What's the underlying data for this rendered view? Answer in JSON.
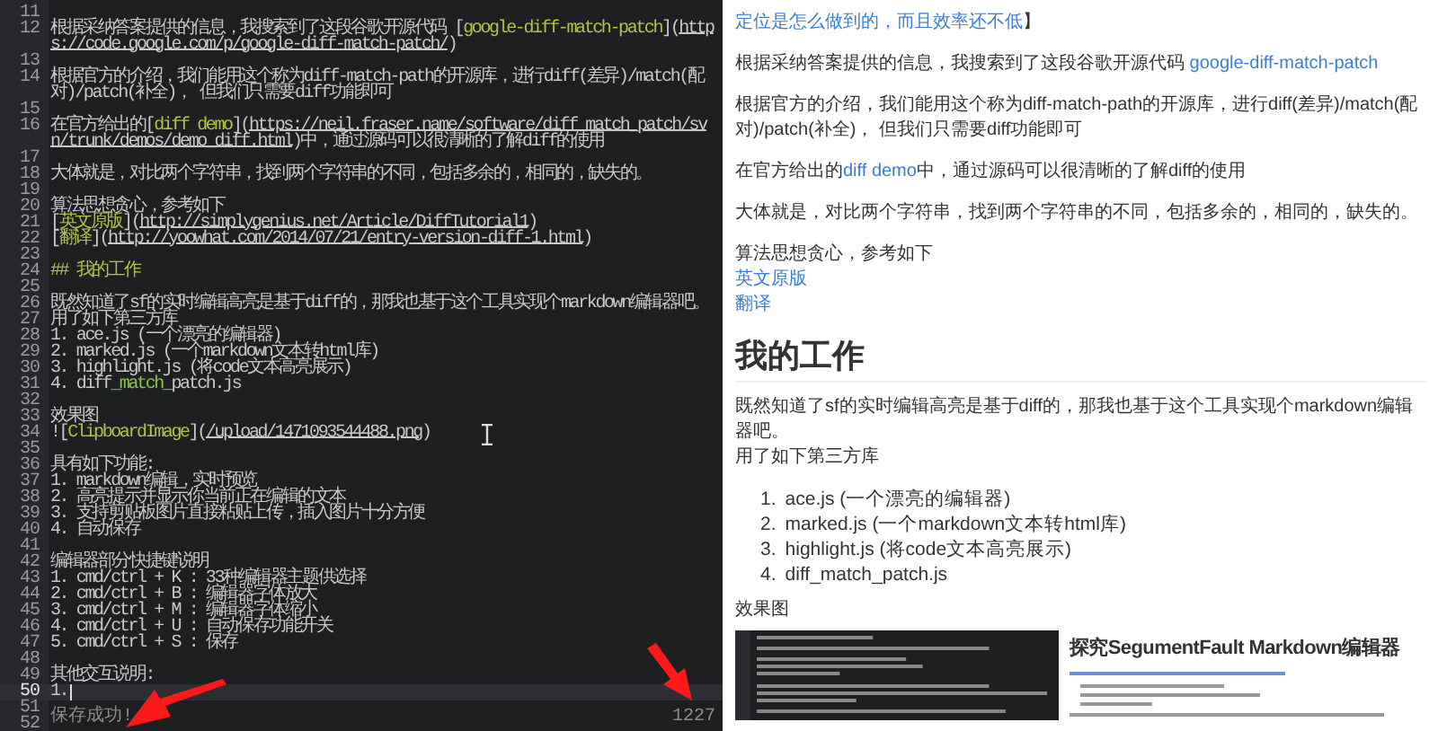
{
  "editor": {
    "lines": [
      {
        "number": "11",
        "current": false
      },
      {
        "number": "12",
        "current": false,
        "segments": [
          {
            "kind": "text",
            "text": "根据采纳答案提供的信息，我搜索到了这段谷歌开源代码 ["
          },
          {
            "kind": "label",
            "text": "google-diff-match-patch"
          },
          {
            "kind": "text",
            "text": "]("
          },
          {
            "kind": "url",
            "text": "https://code.google.com/p/google-diff-match-patch/"
          },
          {
            "kind": "text",
            "text": ")"
          }
        ]
      },
      {
        "number": "13",
        "current": false
      },
      {
        "number": "14",
        "current": false,
        "segments": [
          {
            "kind": "text",
            "text": "根据官方的介绍，我们能用这个称为diff-match-path的开源库，进行diff(差异)/match(配对)/patch(补全)， 但我们只需要diff功能即可"
          }
        ]
      },
      {
        "number": "15",
        "current": false
      },
      {
        "number": "16",
        "current": false,
        "segments": [
          {
            "kind": "text",
            "text": "在官方给出的["
          },
          {
            "kind": "label",
            "text": "diff demo"
          },
          {
            "kind": "text",
            "text": "]("
          },
          {
            "kind": "url",
            "text": "https://neil.fraser.name/software/diff_match_patch/svn/trunk/demos/demo_diff.html"
          },
          {
            "kind": "text",
            "text": ")中，通过源码可以很清晰的了解diff的使用"
          }
        ]
      },
      {
        "number": "17",
        "current": false
      },
      {
        "number": "18",
        "current": false,
        "segments": [
          {
            "kind": "text",
            "text": "大体就是，对比两个字符串，找到两个字符串的不同，包括多余的，相同的，缺失的。"
          }
        ]
      },
      {
        "number": "19",
        "current": false
      },
      {
        "number": "20",
        "current": false,
        "segments": [
          {
            "kind": "text",
            "text": "算法思想贪心，参考如下"
          }
        ]
      },
      {
        "number": "21",
        "current": false,
        "segments": [
          {
            "kind": "text",
            "text": "["
          },
          {
            "kind": "label",
            "text": "英文原版"
          },
          {
            "kind": "text",
            "text": "]("
          },
          {
            "kind": "url",
            "text": "http://simplygenius.net/Article/DiffTutorial1"
          },
          {
            "kind": "text",
            "text": ")"
          }
        ]
      },
      {
        "number": "22",
        "current": false,
        "segments": [
          {
            "kind": "text",
            "text": "["
          },
          {
            "kind": "label",
            "text": "翻译"
          },
          {
            "kind": "text",
            "text": "]("
          },
          {
            "kind": "url",
            "text": "http://yoowhat.com/2014/07/21/entry-version-diff-1.html"
          },
          {
            "kind": "text",
            "text": ")"
          }
        ]
      },
      {
        "number": "23",
        "current": false
      },
      {
        "number": "24",
        "current": false,
        "segments": [
          {
            "kind": "heading",
            "text": "## 我的工作"
          }
        ]
      },
      {
        "number": "25",
        "current": false
      },
      {
        "number": "26",
        "current": false,
        "segments": [
          {
            "kind": "text",
            "text": "既然知道了sf的实时编辑高亮是基于diff的，那我也基于这个工具实现个markdown编辑器吧。"
          }
        ]
      },
      {
        "number": "27",
        "current": false,
        "segments": [
          {
            "kind": "text",
            "text": "用了如下第三方库"
          }
        ]
      },
      {
        "number": "28",
        "current": false,
        "segments": [
          {
            "kind": "text",
            "text": "1. ace.js (一个漂亮的编辑器)"
          }
        ]
      },
      {
        "number": "29",
        "current": false,
        "segments": [
          {
            "kind": "text",
            "text": "2. marked.js (一个markdown文本转html库)"
          }
        ]
      },
      {
        "number": "30",
        "current": false,
        "segments": [
          {
            "kind": "text",
            "text": "3. highlight.js (将code文本高亮展示)"
          }
        ]
      },
      {
        "number": "31",
        "current": false,
        "segments": [
          {
            "kind": "text",
            "text": "4. diff"
          },
          {
            "kind": "emphasis",
            "text": "_match_"
          },
          {
            "kind": "text",
            "text": "patch.js"
          }
        ]
      },
      {
        "number": "32",
        "current": false
      },
      {
        "number": "33",
        "current": false,
        "segments": [
          {
            "kind": "text",
            "text": "效果图"
          }
        ]
      },
      {
        "number": "34",
        "current": false,
        "segments": [
          {
            "kind": "text",
            "text": "!["
          },
          {
            "kind": "label",
            "text": "ClipboardImage"
          },
          {
            "kind": "text",
            "text": "]("
          },
          {
            "kind": "url",
            "text": "/upload/1471093544488.png"
          },
          {
            "kind": "text",
            "text": ")"
          }
        ]
      },
      {
        "number": "35",
        "current": false
      },
      {
        "number": "36",
        "current": false,
        "segments": [
          {
            "kind": "text",
            "text": "具有如下功能:"
          }
        ]
      },
      {
        "number": "37",
        "current": false,
        "segments": [
          {
            "kind": "text",
            "text": "1. markdown编辑，实时预览"
          }
        ]
      },
      {
        "number": "38",
        "current": false,
        "segments": [
          {
            "kind": "text",
            "text": "2. 高亮提示并显示你当前正在编辑的文本"
          }
        ]
      },
      {
        "number": "39",
        "current": false,
        "segments": [
          {
            "kind": "text",
            "text": "3. 支持剪贴板图片直接粘贴上传，插入图片十分方便"
          }
        ]
      },
      {
        "number": "40",
        "current": false,
        "segments": [
          {
            "kind": "text",
            "text": "4. 自动保存"
          }
        ]
      },
      {
        "number": "41",
        "current": false
      },
      {
        "number": "42",
        "current": false,
        "segments": [
          {
            "kind": "text",
            "text": "编辑器部分快捷键说明"
          }
        ]
      },
      {
        "number": "43",
        "current": false,
        "segments": [
          {
            "kind": "text",
            "text": "1. cmd/ctrl + K : 33种编辑器主题供选择"
          }
        ]
      },
      {
        "number": "44",
        "current": false,
        "segments": [
          {
            "kind": "text",
            "text": "2. cmd/ctrl + B : 编辑器字体放大"
          }
        ]
      },
      {
        "number": "45",
        "current": false,
        "segments": [
          {
            "kind": "text",
            "text": "3. cmd/ctrl + M : 编辑器字体缩小"
          }
        ]
      },
      {
        "number": "46",
        "current": false,
        "segments": [
          {
            "kind": "text",
            "text": "4. cmd/ctrl + U : 自动保存功能开关"
          }
        ]
      },
      {
        "number": "47",
        "current": false,
        "segments": [
          {
            "kind": "text",
            "text": "5. cmd/ctrl + S : 保存"
          }
        ]
      },
      {
        "number": "48",
        "current": false
      },
      {
        "number": "49",
        "current": false,
        "segments": [
          {
            "kind": "text",
            "text": "其他交互说明:"
          }
        ]
      },
      {
        "number": "50",
        "current": true,
        "segments": [
          {
            "kind": "text",
            "text": "1."
          }
        ]
      },
      {
        "number": "51",
        "current": false
      },
      {
        "number": "52",
        "current": false
      }
    ],
    "status_bar": {
      "message": "保存成功!",
      "count": "1227"
    }
  },
  "preview": {
    "blocks": [
      {
        "kind": "paragraph",
        "parts": [
          {
            "kind": "link",
            "text": "定位是怎么做到的，而且效率还不低"
          },
          {
            "kind": "text",
            "text": "】"
          }
        ]
      },
      {
        "kind": "paragraph",
        "parts": [
          {
            "kind": "text",
            "text": "根据采纳答案提供的信息，我搜索到了这段谷歌开源代码 "
          },
          {
            "kind": "link",
            "text": "google-diff-match-patch"
          }
        ]
      },
      {
        "kind": "paragraph",
        "parts": [
          {
            "kind": "text",
            "text": "根据官方的介绍，我们能用这个称为diff-match-path的开源库，进行diff(差异)/match(配对)/patch(补全)， 但我们只需要diff功能即可"
          }
        ]
      },
      {
        "kind": "paragraph",
        "parts": [
          {
            "kind": "text",
            "text": "在官方给出的"
          },
          {
            "kind": "link",
            "text": "diff demo"
          },
          {
            "kind": "text",
            "text": "中，通过源码可以很清晰的了解diff的使用"
          }
        ]
      },
      {
        "kind": "paragraph",
        "parts": [
          {
            "kind": "text",
            "text": "大体就是，对比两个字符串，找到两个字符串的不同，包括多余的，相同的，缺失的。"
          }
        ]
      },
      {
        "kind": "paragraph",
        "parts": [
          {
            "kind": "text",
            "text": "算法思想贪心，参考如下"
          },
          {
            "kind": "break"
          },
          {
            "kind": "link",
            "text": "英文原版"
          },
          {
            "kind": "break"
          },
          {
            "kind": "link",
            "text": "翻译"
          }
        ]
      },
      {
        "kind": "heading",
        "text": "我的工作"
      },
      {
        "kind": "paragraph",
        "parts": [
          {
            "kind": "text",
            "text": "既然知道了sf的实时编辑高亮是基于diff的，那我也基于这个工具实现个markdown编辑器吧。"
          },
          {
            "kind": "break"
          },
          {
            "kind": "text",
            "text": "用了如下第三方库"
          }
        ]
      },
      {
        "kind": "list",
        "items": [
          {
            "number": "1.",
            "text": "ace.js (一个漂亮的编辑器)"
          },
          {
            "number": "2.",
            "text": "marked.js (一个markdown文本转html库)"
          },
          {
            "number": "3.",
            "text": "highlight.js (将code文本高亮展示)"
          },
          {
            "number": "4.",
            "text": "diff_match_patch.js"
          }
        ]
      },
      {
        "kind": "paragraph",
        "parts": [
          {
            "kind": "text",
            "text": "效果图"
          }
        ]
      },
      {
        "kind": "screenshot",
        "title": "探究SegumentFault Markdown编辑器"
      }
    ]
  }
}
